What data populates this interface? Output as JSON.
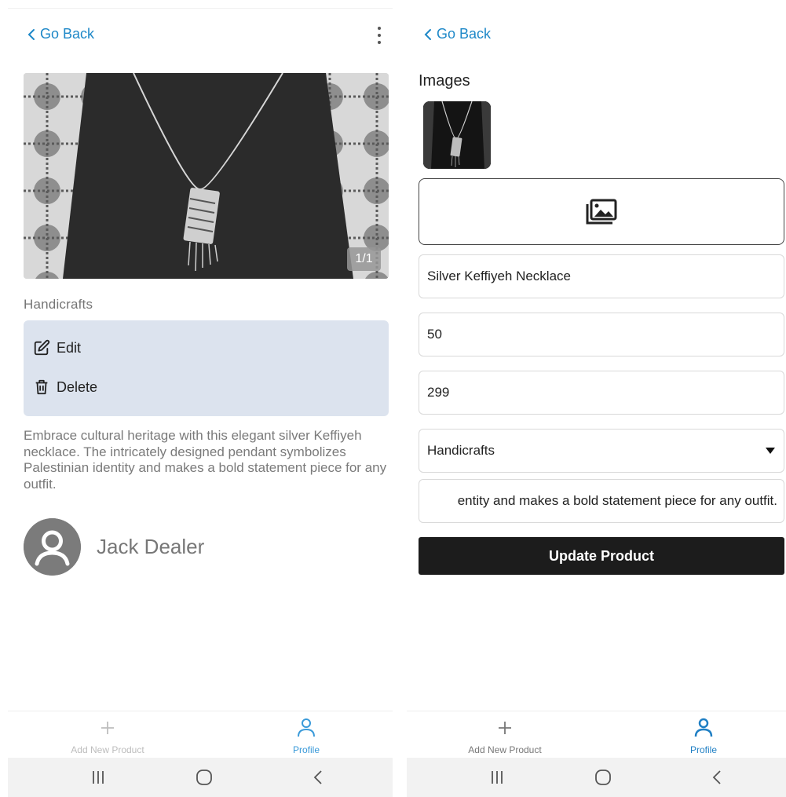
{
  "left": {
    "go_back": "Go Back",
    "image_counter": "1/1",
    "category": "Handicrafts",
    "actions": {
      "edit": "Edit",
      "delete": "Delete"
    },
    "description": "Embrace cultural heritage with this elegant silver Keffiyeh necklace. The intricately designed pendant symbolizes Palestinian identity and makes a bold statement piece for any outfit.",
    "dealer_name": "Jack Dealer",
    "nav": {
      "add": "Add New Product",
      "profile": "Profile"
    }
  },
  "right": {
    "go_back": "Go Back",
    "images_title": "Images",
    "fields": {
      "name": "Silver Keffiyeh Necklace",
      "quantity": "50",
      "price": "299",
      "category": "Handicrafts",
      "description_tail": "entity and makes a bold statement piece for any outfit."
    },
    "update_button": "Update Product",
    "nav": {
      "add": "Add New Product",
      "profile": "Profile"
    }
  },
  "colors": {
    "link_blue": "#1e88c8",
    "actions_bg": "#dce3ee",
    "button_dark": "#1c1c1c",
    "nav_active": "#3a9ad9"
  },
  "icons": {
    "back": "chevron-left-icon",
    "more": "kebab-menu-icon",
    "edit": "pencil-square-icon",
    "delete": "trash-icon",
    "avatar": "user-avatar-icon",
    "add": "plus-icon",
    "profile": "person-icon",
    "upload": "image-gallery-icon",
    "dropdown": "caret-down-icon"
  }
}
